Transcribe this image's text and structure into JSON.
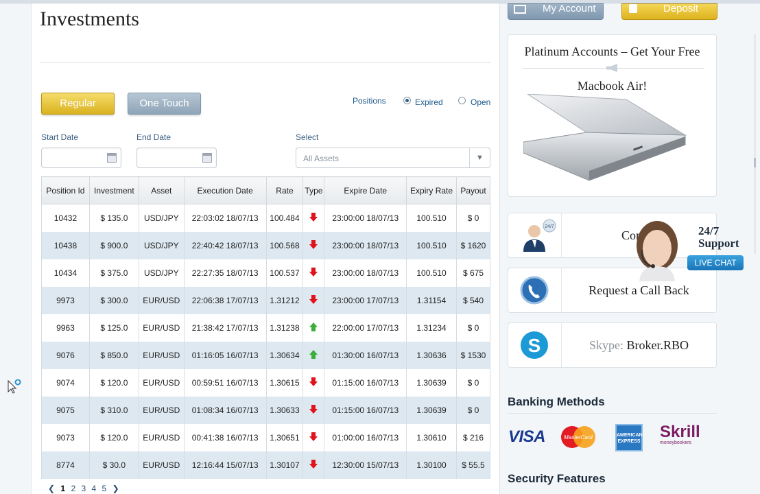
{
  "page": {
    "title": "Investments"
  },
  "tabs": {
    "regular": "Regular",
    "one_touch": "One Touch"
  },
  "positions": {
    "label": "Positions",
    "expired": "Expired",
    "open": "Open",
    "selected": "Expired"
  },
  "filters": {
    "start_date_label": "Start Date",
    "end_date_label": "End Date",
    "select_label": "Select",
    "select_value": "All Assets"
  },
  "table": {
    "headers": [
      "Position Id",
      "Investment",
      "Asset",
      "Execution Date",
      "Rate",
      "Type",
      "Expire Date",
      "Expiry Rate",
      "Payout"
    ],
    "rows": [
      {
        "id": "10432",
        "investment": "$ 135.0",
        "asset": "USD/JPY",
        "exec": "22:03:02 18/07/13",
        "rate": "100.484",
        "type": "down",
        "expire": "23:00:00 18/07/13",
        "expiry_rate": "100.510",
        "payout": "$ 0"
      },
      {
        "id": "10438",
        "investment": "$ 900.0",
        "asset": "USD/JPY",
        "exec": "22:40:42 18/07/13",
        "rate": "100.568",
        "type": "down",
        "expire": "23:00:00 18/07/13",
        "expiry_rate": "100.510",
        "payout": "$ 1620"
      },
      {
        "id": "10434",
        "investment": "$ 375.0",
        "asset": "USD/JPY",
        "exec": "22:27:35 18/07/13",
        "rate": "100.537",
        "type": "down",
        "expire": "23:00:00 18/07/13",
        "expiry_rate": "100.510",
        "payout": "$ 675"
      },
      {
        "id": "9973",
        "investment": "$ 300.0",
        "asset": "EUR/USD",
        "exec": "22:06:38 17/07/13",
        "rate": "1.31212",
        "type": "down",
        "expire": "23:00:00 17/07/13",
        "expiry_rate": "1.31154",
        "payout": "$ 540"
      },
      {
        "id": "9963",
        "investment": "$ 125.0",
        "asset": "EUR/USD",
        "exec": "21:38:42 17/07/13",
        "rate": "1.31238",
        "type": "up",
        "expire": "22:00:00 17/07/13",
        "expiry_rate": "1.31234",
        "payout": "$ 0"
      },
      {
        "id": "9076",
        "investment": "$ 850.0",
        "asset": "EUR/USD",
        "exec": "01:16:05 16/07/13",
        "rate": "1.30634",
        "type": "up",
        "expire": "01:30:00 16/07/13",
        "expiry_rate": "1.30636",
        "payout": "$ 1530"
      },
      {
        "id": "9074",
        "investment": "$ 120.0",
        "asset": "EUR/USD",
        "exec": "00:59:51 16/07/13",
        "rate": "1.30615",
        "type": "down",
        "expire": "01:15:00 16/07/13",
        "expiry_rate": "1.30639",
        "payout": "$ 0"
      },
      {
        "id": "9075",
        "investment": "$ 310.0",
        "asset": "EUR/USD",
        "exec": "01:08:34 16/07/13",
        "rate": "1.30633",
        "type": "down",
        "expire": "01:15:00 16/07/13",
        "expiry_rate": "1.30639",
        "payout": "$ 0"
      },
      {
        "id": "9073",
        "investment": "$ 120.0",
        "asset": "EUR/USD",
        "exec": "00:41:38 16/07/13",
        "rate": "1.30651",
        "type": "down",
        "expire": "01:00:00 16/07/13",
        "expiry_rate": "1.30610",
        "payout": "$ 216"
      },
      {
        "id": "8774",
        "investment": "$ 30.0",
        "asset": "EUR/USD",
        "exec": "12:16:44 15/07/13",
        "rate": "1.30107",
        "type": "down",
        "expire": "12:30:00 15/07/13",
        "expiry_rate": "1.30100",
        "payout": "$ 55.5"
      }
    ]
  },
  "pagination": {
    "pages": [
      "1",
      "2",
      "3",
      "4",
      "5"
    ],
    "current": "1"
  },
  "sidebar": {
    "my_account": "My Account",
    "deposit": "Deposit",
    "promo_title": "Platinum Accounts – Get Your Free",
    "promo_sub": "Macbook Air!",
    "contact": "Contac",
    "callback": "Request a Call Back",
    "skype_label": "Skype:",
    "skype_id": "Broker.RBO",
    "live_support_line1": "24/7",
    "live_support_line2": "Support",
    "live_chat": "LIVE CHAT",
    "badge_247": "24/7",
    "banking_heading": "Banking Methods",
    "security_heading": "Security Features",
    "bank_visa": "VISA",
    "bank_mastercard": "MasterCard",
    "bank_amex_lines": [
      "AMERICAN",
      "EXPRESS"
    ],
    "bank_skrill": "Skrill",
    "bank_skrill_sub": "moneybookers"
  },
  "colors": {
    "regular_btn": "#d9b21f",
    "one_touch_btn": "#8ea4b8",
    "down_arrow": "#e0121b",
    "up_arrow": "#3cae3c",
    "row_alt": "#dde8f0",
    "link_blue": "#1d5a8c"
  }
}
